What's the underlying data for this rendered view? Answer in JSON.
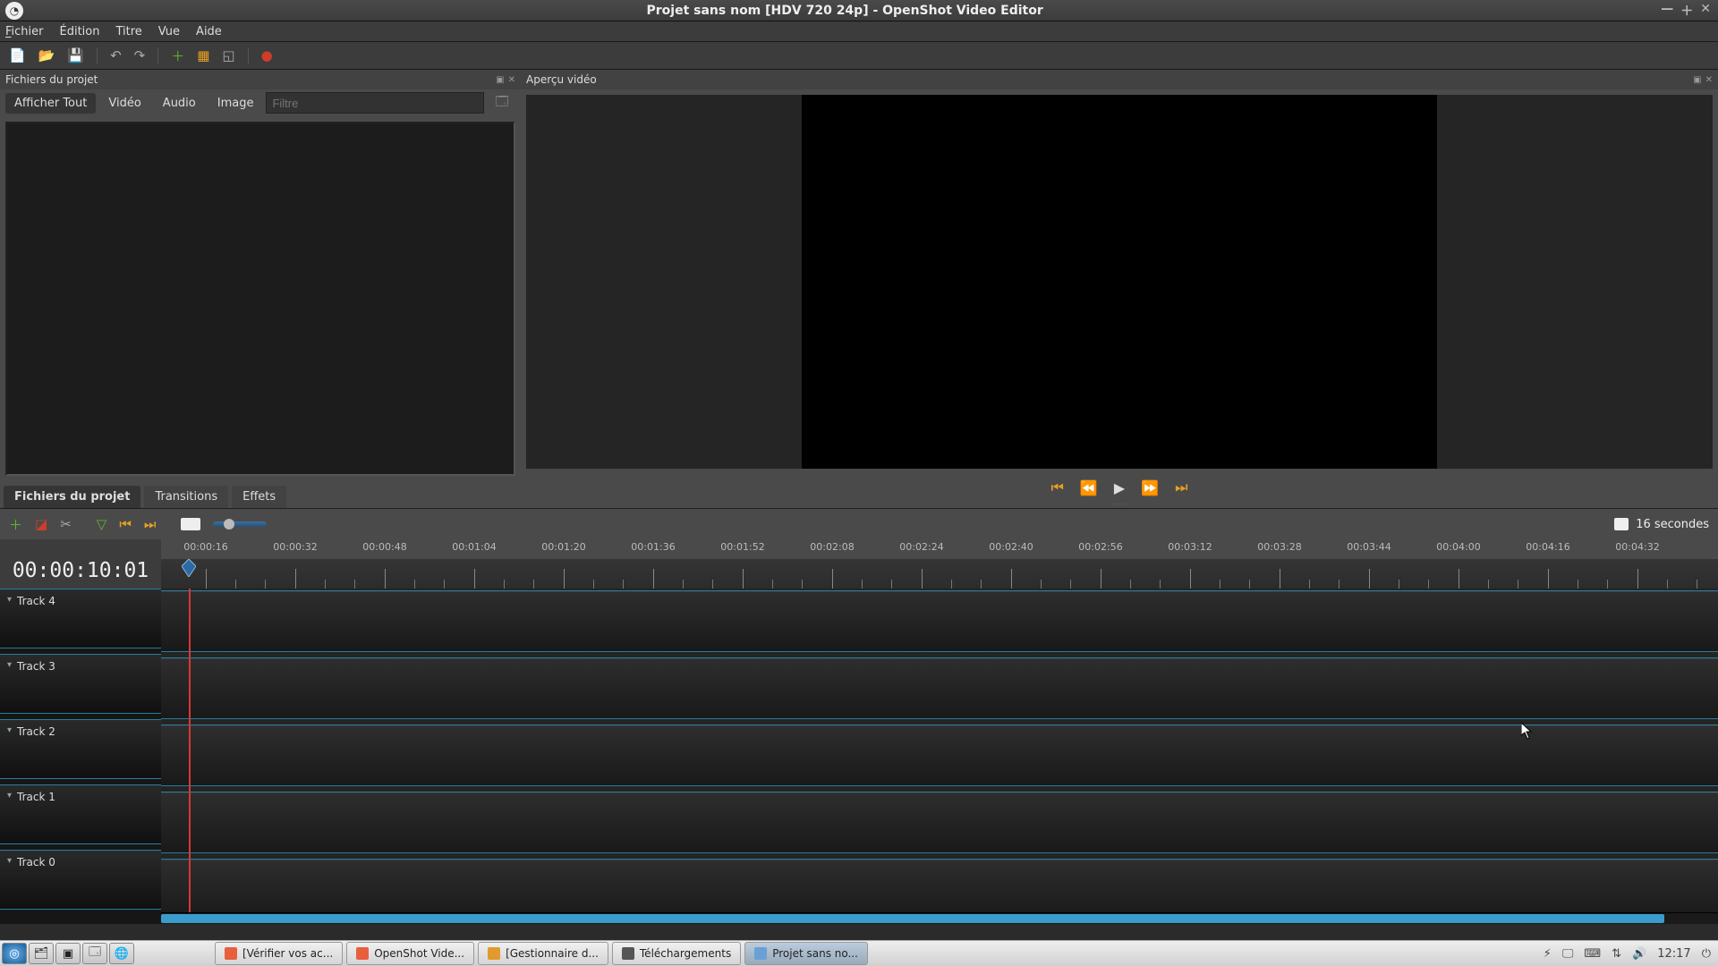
{
  "window": {
    "title": "Projet sans nom [HDV 720 24p] - OpenShot Video Editor"
  },
  "menu": {
    "file": "Fichier",
    "edit": "Édition",
    "title": "Titre",
    "view": "Vue",
    "help": "Aide"
  },
  "panels": {
    "project_files": "Fichiers du projet",
    "preview": "Aperçu vidéo"
  },
  "filter_tabs": {
    "show_all": "Afficher Tout",
    "video": "Vidéo",
    "audio": "Audio",
    "image": "Image",
    "placeholder": "Filtre"
  },
  "lower_tabs": {
    "project_files": "Fichiers du projet",
    "transitions": "Transitions",
    "effects": "Effets"
  },
  "timeline": {
    "current_time": "00:00:10:01",
    "duration_label": "16 secondes",
    "ticks": [
      "00:00:16",
      "00:00:32",
      "00:00:48",
      "00:01:04",
      "00:01:20",
      "00:01:36",
      "00:01:52",
      "00:02:08",
      "00:02:24",
      "00:02:40",
      "00:02:56",
      "00:03:12",
      "00:03:28",
      "00:03:44",
      "00:04:00",
      "00:04:16",
      "00:04:32"
    ],
    "tracks": [
      "Track 4",
      "Track 3",
      "Track 2",
      "Track 1",
      "Track 0"
    ]
  },
  "taskbar": {
    "items": [
      {
        "label": "[Vérifier vos ac...",
        "active": false
      },
      {
        "label": "OpenShot Vide...",
        "active": false
      },
      {
        "label": "[Gestionnaire d...",
        "active": false
      },
      {
        "label": "Téléchargements",
        "active": false
      },
      {
        "label": "Projet sans no...",
        "active": true
      }
    ],
    "clock": "12:17"
  }
}
